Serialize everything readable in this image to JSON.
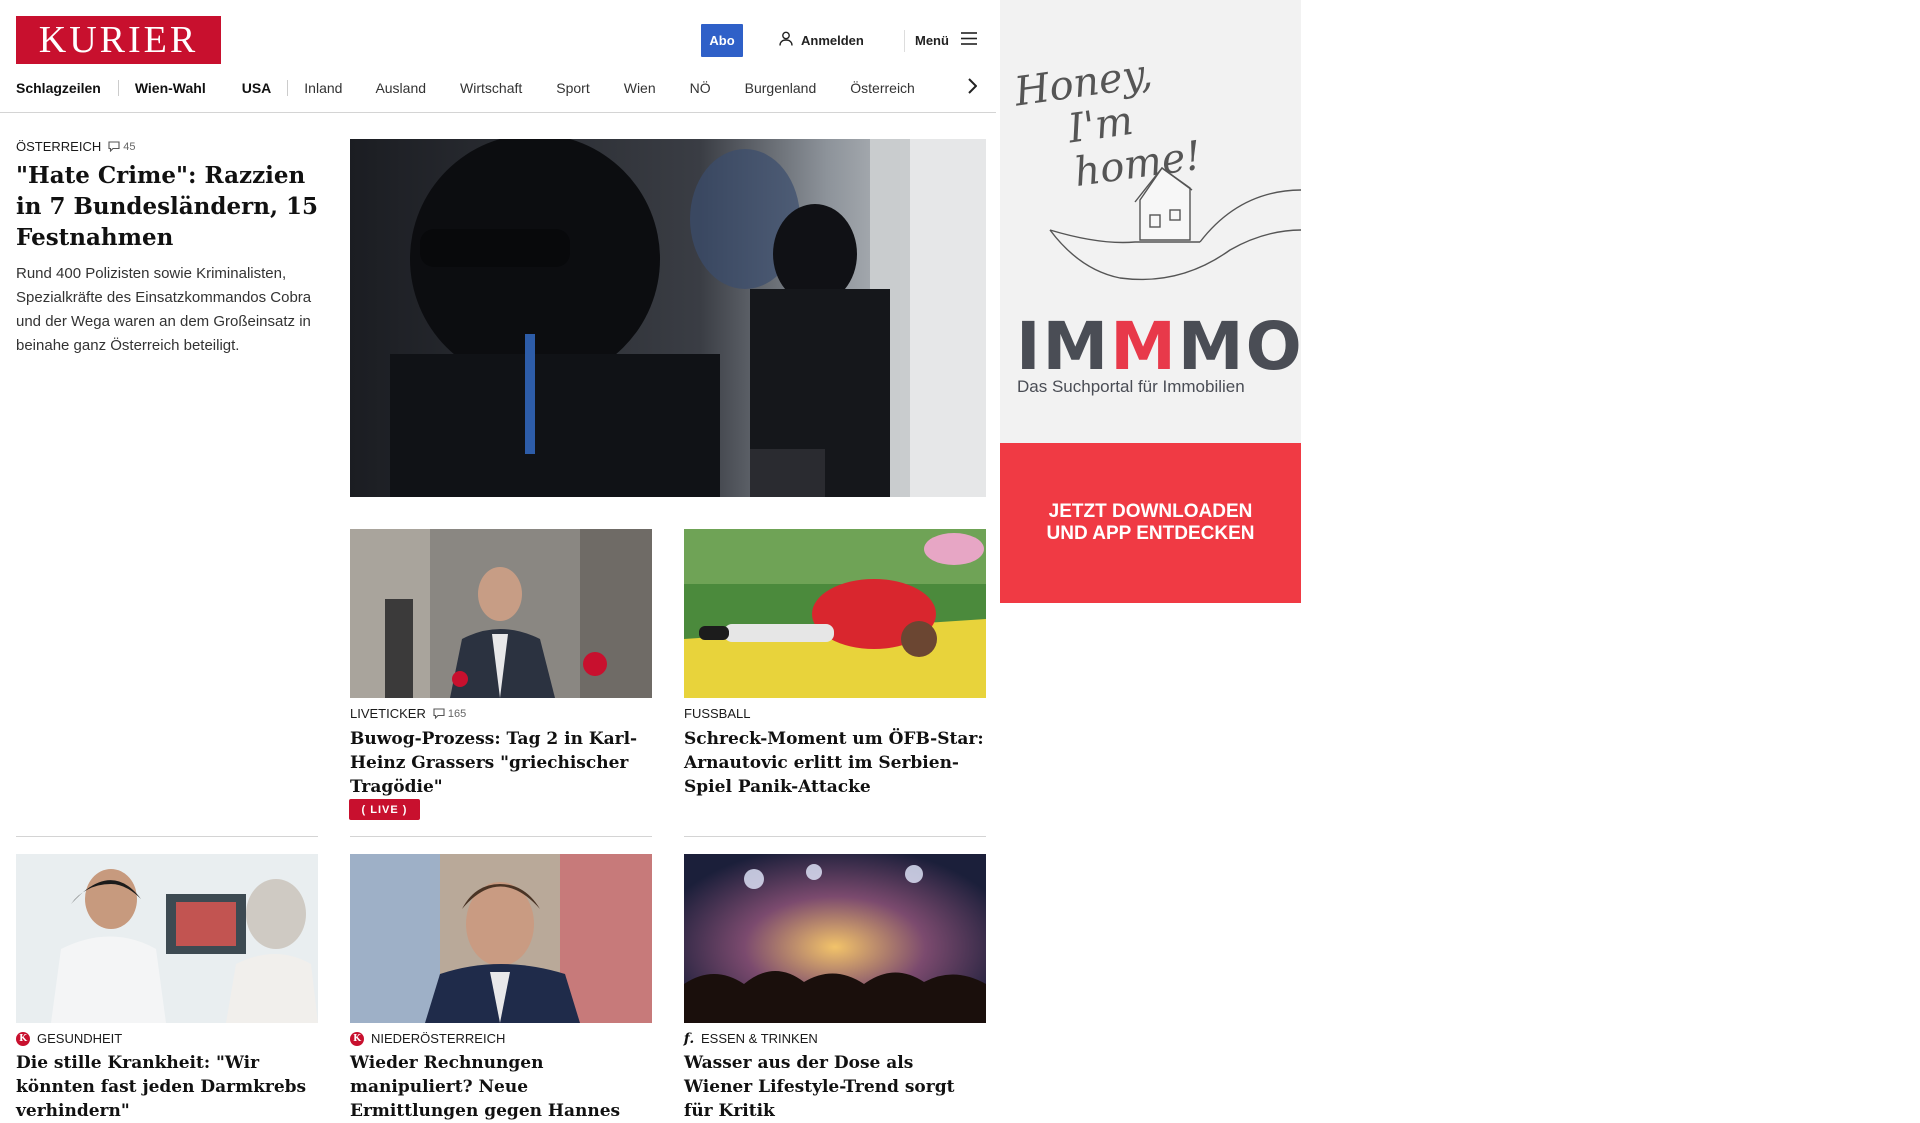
{
  "header": {
    "logo": "KURIER",
    "abo_label": "Abo",
    "login_label": "Anmelden",
    "menu_label": "Menü"
  },
  "nav": {
    "items": [
      "Schlagzeilen",
      "Wien-Wahl",
      "USA",
      "Inland",
      "Ausland",
      "Wirtschaft",
      "Sport",
      "Wien",
      "NÖ",
      "Burgenland",
      "Österreich"
    ]
  },
  "lead": {
    "kicker": "ÖSTERREICH",
    "comments": "45",
    "headline": "\"Hate Crime\": Razzien in 7 Bundesländern, 15 Festnahmen",
    "text": "Rund 400 Polizisten sowie Kriminalisten, Spezialkräfte des Einsatzkommandos Cobra und der Wega waren an dem Großeinsatz in beinahe ganz Österreich beteiligt."
  },
  "cards": [
    {
      "kicker": "LIVETICKER",
      "comments": "165",
      "headline": "Buwog-Prozess: Tag 2 in Karl-Heinz Grassers \"griechischer Tragödie\"",
      "badge": "LIVE"
    },
    {
      "kicker": "FUSSBALL",
      "headline": "Schreck-Moment um ÖFB-Star: Arnautovic erlitt im Serbien-Spiel Panik-Attacke"
    },
    {
      "kicker": "GESUNDHEIT",
      "headline": "Die stille Krankheit: \"Wir könnten fast jeden Darmkrebs verhindern\""
    },
    {
      "kicker": "NIEDERÖSTERREICH",
      "headline": "Wieder Rechnungen manipuliert? Neue Ermittlungen gegen Hannes"
    },
    {
      "kicker": "ESSEN & TRINKEN",
      "headline": "Wasser aus der Dose als Wiener Lifestyle-Trend sorgt für Kritik"
    }
  ],
  "ad": {
    "script_line1": "Honey,",
    "script_line2": "I'm home!",
    "brand_a": "IM",
    "brand_b": "M",
    "brand_c": "MO",
    "subtitle": "Das Suchportal für Immobilien",
    "cta_line1": "JETZT DOWNLOADEN",
    "cta_line2": "UND APP ENTDECKEN"
  },
  "colors": {
    "brand_red": "#c8102e",
    "abo_blue": "#2f60c8",
    "ad_red": "#f03a44"
  }
}
